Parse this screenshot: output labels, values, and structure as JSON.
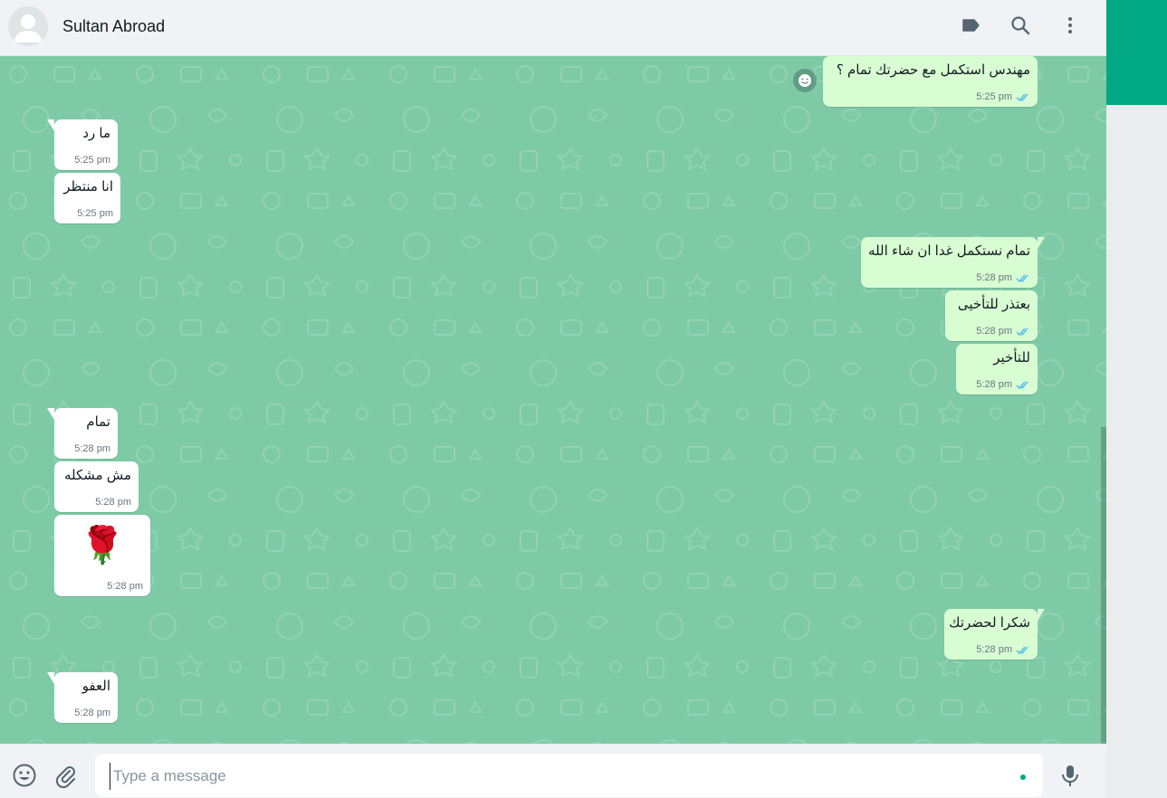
{
  "header": {
    "contact_name": "Sultan Abroad"
  },
  "messages": [
    {
      "dir": "out",
      "text": "مهندس استكمل مع حضرتك تمام ؟",
      "time": "5:25 pm",
      "read": true
    },
    {
      "dir": "in",
      "text": "ما رد",
      "time": "5:25 pm"
    },
    {
      "dir": "in",
      "text": "انا منتظر",
      "time": "5:25 pm"
    },
    {
      "dir": "out",
      "text": "تمام نستكمل غدا ان شاء الله",
      "time": "5:28 pm",
      "read": true
    },
    {
      "dir": "out",
      "text": "بعتذر للتأخيى",
      "time": "5:28 pm",
      "read": true
    },
    {
      "dir": "out",
      "text": "للتأخير",
      "time": "5:28 pm",
      "read": true
    },
    {
      "dir": "in",
      "text": "تمام",
      "time": "5:28 pm"
    },
    {
      "dir": "in",
      "text": "مش مشكله",
      "time": "5:28 pm"
    },
    {
      "dir": "in",
      "text": "🌹",
      "time": "5:28 pm",
      "sticker": true
    },
    {
      "dir": "out",
      "text": "شكرا لحضرتك",
      "time": "5:28 pm",
      "read": true
    },
    {
      "dir": "in",
      "text": "العفو",
      "time": "5:28 pm"
    }
  ],
  "composer": {
    "placeholder": "Type a message"
  },
  "icons": {
    "header": [
      "label-icon",
      "search-icon",
      "menu-icon"
    ],
    "footer": [
      "emoji-icon",
      "attach-icon",
      "mic-icon"
    ]
  },
  "colors": {
    "chat_background": "#7ecaa6",
    "incoming_bubble": "#ffffff",
    "outgoing_bubble": "#d9fdd3",
    "accent": "#00a884",
    "read_ticks": "#53bdeb"
  }
}
